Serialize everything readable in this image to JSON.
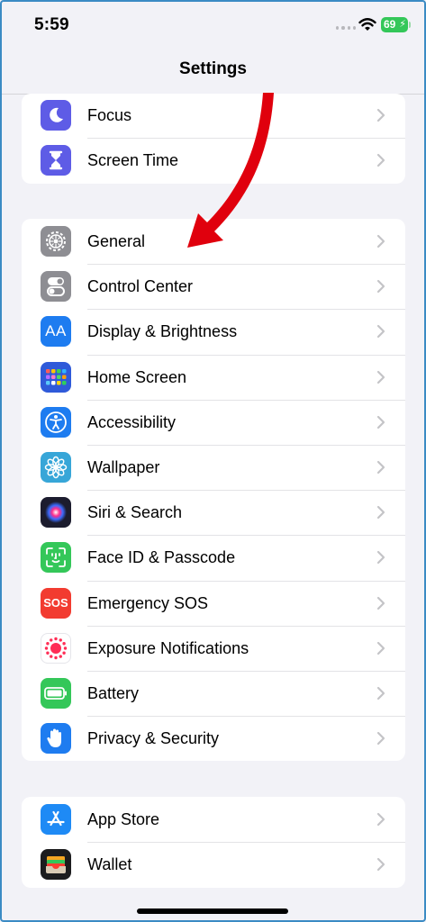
{
  "status_bar": {
    "time": "5:59",
    "battery": "69"
  },
  "nav": {
    "title": "Settings"
  },
  "groups": [
    {
      "items": [
        {
          "label": "Focus",
          "icon": "moon-icon",
          "color": "#5e5ce6"
        },
        {
          "label": "Screen Time",
          "icon": "hourglass-icon",
          "color": "#5e5ce6"
        }
      ]
    },
    {
      "items": [
        {
          "label": "General",
          "icon": "gear-icon",
          "color": "#8e8e93"
        },
        {
          "label": "Control Center",
          "icon": "toggles-icon",
          "color": "#8e8e93"
        },
        {
          "label": "Display & Brightness",
          "icon": "text-size-icon",
          "color": "#1e7cf0"
        },
        {
          "label": "Home Screen",
          "icon": "app-grid-icon",
          "color": "#2f5ad9"
        },
        {
          "label": "Accessibility",
          "icon": "accessibility-icon",
          "color": "#1e7cf0"
        },
        {
          "label": "Wallpaper",
          "icon": "flower-icon",
          "color": "#37a6d8"
        },
        {
          "label": "Siri & Search",
          "icon": "siri-icon",
          "color": "#1c1c2e"
        },
        {
          "label": "Face ID & Passcode",
          "icon": "face-id-icon",
          "color": "#34c759"
        },
        {
          "label": "Emergency SOS",
          "icon": "sos-icon",
          "color": "#f23b30"
        },
        {
          "label": "Exposure Notifications",
          "icon": "exposure-icon",
          "color": "#ffffff"
        },
        {
          "label": "Battery",
          "icon": "battery-icon",
          "color": "#34c759"
        },
        {
          "label": "Privacy & Security",
          "icon": "hand-icon",
          "color": "#1e7cf0"
        }
      ]
    },
    {
      "items": [
        {
          "label": "App Store",
          "icon": "app-store-icon",
          "color": "#1e8af5"
        },
        {
          "label": "Wallet",
          "icon": "wallet-icon",
          "color": "#1c1c1e"
        }
      ]
    }
  ],
  "sos_text": "SOS",
  "text_size_text": "AA",
  "annotation": {
    "arrow_color": "#e0000d"
  }
}
